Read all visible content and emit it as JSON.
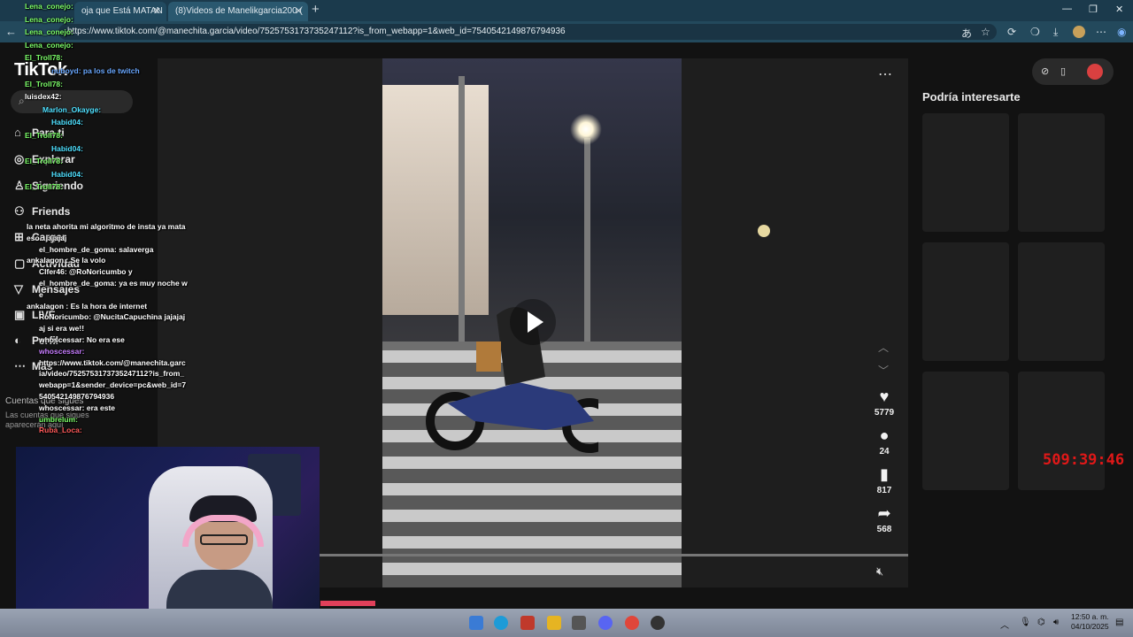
{
  "browser": {
    "tabs": [
      {
        "label": "oja que Está MATAN"
      },
      {
        "label": "(8)Videos de Manelikgarcia200 ("
      }
    ],
    "new_tab": "+",
    "url": "https://www.tiktok.com/@manechita.garcia/video/7525753173735247112?is_from_webapp=1&web_id=7540542149876794936",
    "window_controls": [
      "—",
      "❐",
      "✕"
    ]
  },
  "tiktok": {
    "logo": "TikTok",
    "search_placeholder": "",
    "nav": [
      {
        "label": "Para ti",
        "icon": "home-icon"
      },
      {
        "label": "Explorar",
        "icon": "compass-icon"
      },
      {
        "label": "Siguiendo",
        "icon": "person-icon"
      },
      {
        "label": "Friends",
        "icon": "friends-icon"
      },
      {
        "label": "Cargar",
        "icon": "upload-icon"
      },
      {
        "label": "Actividad",
        "icon": "activity-icon"
      },
      {
        "label": "Mensajes",
        "icon": "messages-icon"
      },
      {
        "label": "LIVE",
        "icon": "live-icon"
      },
      {
        "label": "Perfil",
        "icon": "profile-icon"
      },
      {
        "label": "Más",
        "icon": "more-icon"
      }
    ],
    "following_heading": "Cuentas que sigues",
    "following_sub": "Las cuentas que sigues aparecerán aquí",
    "actions": [
      {
        "name": "like",
        "icon": "heart-icon",
        "count": "5779"
      },
      {
        "name": "comment",
        "icon": "comment-icon",
        "count": "24"
      },
      {
        "name": "save",
        "icon": "bookmark-icon",
        "count": "817"
      },
      {
        "name": "share",
        "icon": "share-icon",
        "count": "568"
      }
    ],
    "recommended_title": "Podría interesarte"
  },
  "stream": {
    "timer": "509:39:46",
    "chat_top": [
      {
        "user": "Lena_conejo:",
        "color": "u-green"
      },
      {
        "user": "Lena_conejo:",
        "color": "u-green"
      },
      {
        "user": "Lena_conejo:",
        "color": "u-green"
      },
      {
        "user": "Lena_conejo:",
        "color": "u-green"
      },
      {
        "user": "El_Troll78:",
        "color": "u-green"
      },
      {
        "user": "nuboyd: pa los de twitch",
        "color": "u-blue"
      },
      {
        "user": "El_Troll78:",
        "color": "u-green"
      },
      {
        "user": "luisdex42:",
        "color": "u-white"
      },
      {
        "user": "Marlon_Okayge:",
        "color": "u-cyan"
      },
      {
        "user": "Habid04:",
        "color": "u-cyan"
      },
      {
        "user": "El_Troll78:",
        "color": "u-green"
      },
      {
        "user": "Habid04:",
        "color": "u-cyan"
      },
      {
        "user": "El_Troll78:",
        "color": "u-green"
      },
      {
        "user": "Habid04:",
        "color": "u-cyan"
      },
      {
        "user": "El_Troll78:",
        "color": "u-green"
      }
    ],
    "chat_bottom": [
      {
        "text": "la neta ahorita mi algoritmo de insta ya mata eso.. jajajaj",
        "color": "u-white"
      },
      {
        "text": "el_hombre_de_goma: salaverga",
        "color": "u-white"
      },
      {
        "text": "ankalagon : Se la volo",
        "color": "u-white"
      },
      {
        "text": "Clfer46: @RoNoricumbo y",
        "color": "u-white"
      },
      {
        "text": "el_hombre_de_goma: ya es muy noche we",
        "color": "u-white"
      },
      {
        "text": "ankalagon : Es la hora de internet",
        "color": "u-white"
      },
      {
        "text": "RoNoricumbo: @NucitaCapuchina jajajajaj si era we!!",
        "color": "u-white"
      },
      {
        "text": "whoscessar: No era ese",
        "color": "u-white"
      },
      {
        "text": "whoscessar:",
        "color": "u-purple"
      },
      {
        "text": "https://www.tiktok.com/@manechita.garcia/video/7525753173735247112?is_from_webapp=1&sender_device=pc&web_id=7540542149876794936",
        "color": "u-white"
      },
      {
        "text": "whoscessar: era este",
        "color": "u-white"
      },
      {
        "text": "umbrelum:",
        "color": "u-green"
      },
      {
        "text": "Ruba_Loca:",
        "color": "u-red"
      }
    ]
  },
  "taskbar": {
    "time": "12:50 a. m.",
    "date": "04/10/2025"
  }
}
